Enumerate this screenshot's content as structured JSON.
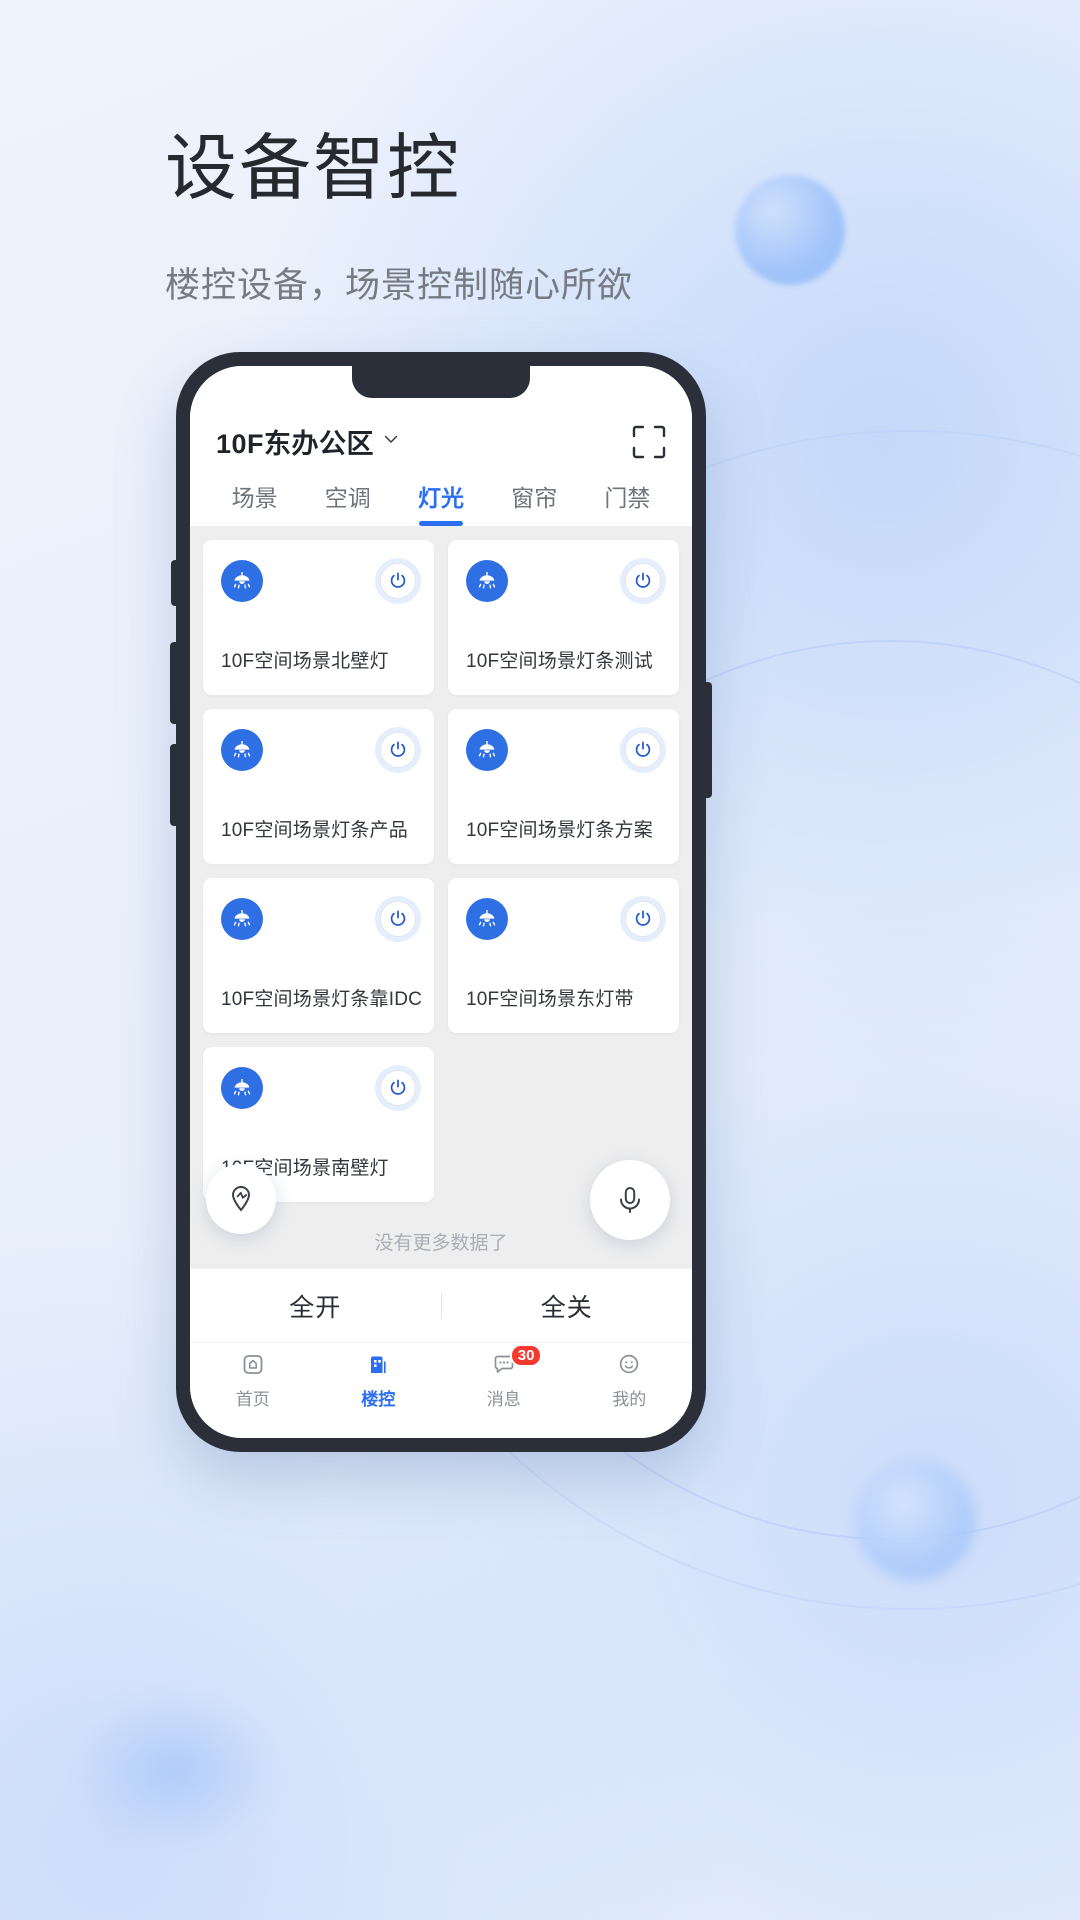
{
  "page": {
    "title": "设备智控",
    "subtitle": "楼控设备，场景控制随心所欲",
    "accent_color": "#2c6ef2",
    "background_color": "#eaf0fb"
  },
  "app": {
    "header": {
      "location": "10F东办公区",
      "chevron_icon": "chevron-down-icon",
      "scan_icon": "scan-code-icon"
    },
    "tabs": [
      {
        "label": "场景",
        "active": false
      },
      {
        "label": "空调",
        "active": false
      },
      {
        "label": "灯光",
        "active": true
      },
      {
        "label": "窗帘",
        "active": false
      },
      {
        "label": "门禁",
        "active": false
      }
    ],
    "devices": [
      {
        "name": "10F空间场景北壁灯",
        "icon": "ceiling-lamp-icon",
        "power_icon": "power-icon"
      },
      {
        "name": "10F空间场景灯条测试",
        "icon": "ceiling-lamp-icon",
        "power_icon": "power-icon"
      },
      {
        "name": "10F空间场景灯条产品",
        "icon": "ceiling-lamp-icon",
        "power_icon": "power-icon"
      },
      {
        "name": "10F空间场景灯条方案",
        "icon": "ceiling-lamp-icon",
        "power_icon": "power-icon"
      },
      {
        "name": "10F空间场景灯条靠IDC",
        "icon": "ceiling-lamp-icon",
        "power_icon": "power-icon"
      },
      {
        "name": "10F空间场景东灯带",
        "icon": "ceiling-lamp-icon",
        "power_icon": "power-icon"
      },
      {
        "name": "10F空间场景南壁灯",
        "icon": "ceiling-lamp-icon",
        "power_icon": "power-icon"
      }
    ],
    "list_footer": "没有更多数据了",
    "floating": {
      "location_icon": "map-pin-icon",
      "mic_icon": "microphone-icon"
    },
    "all_controls": {
      "all_on": "全开",
      "all_off": "全关"
    },
    "bottom_nav": [
      {
        "label": "首页",
        "icon": "home-icon",
        "active": false,
        "badge": ""
      },
      {
        "label": "楼控",
        "icon": "building-control-icon",
        "active": true,
        "badge": ""
      },
      {
        "label": "消息",
        "icon": "message-icon",
        "active": false,
        "badge": "30"
      },
      {
        "label": "我的",
        "icon": "profile-icon",
        "active": false,
        "badge": ""
      }
    ]
  }
}
